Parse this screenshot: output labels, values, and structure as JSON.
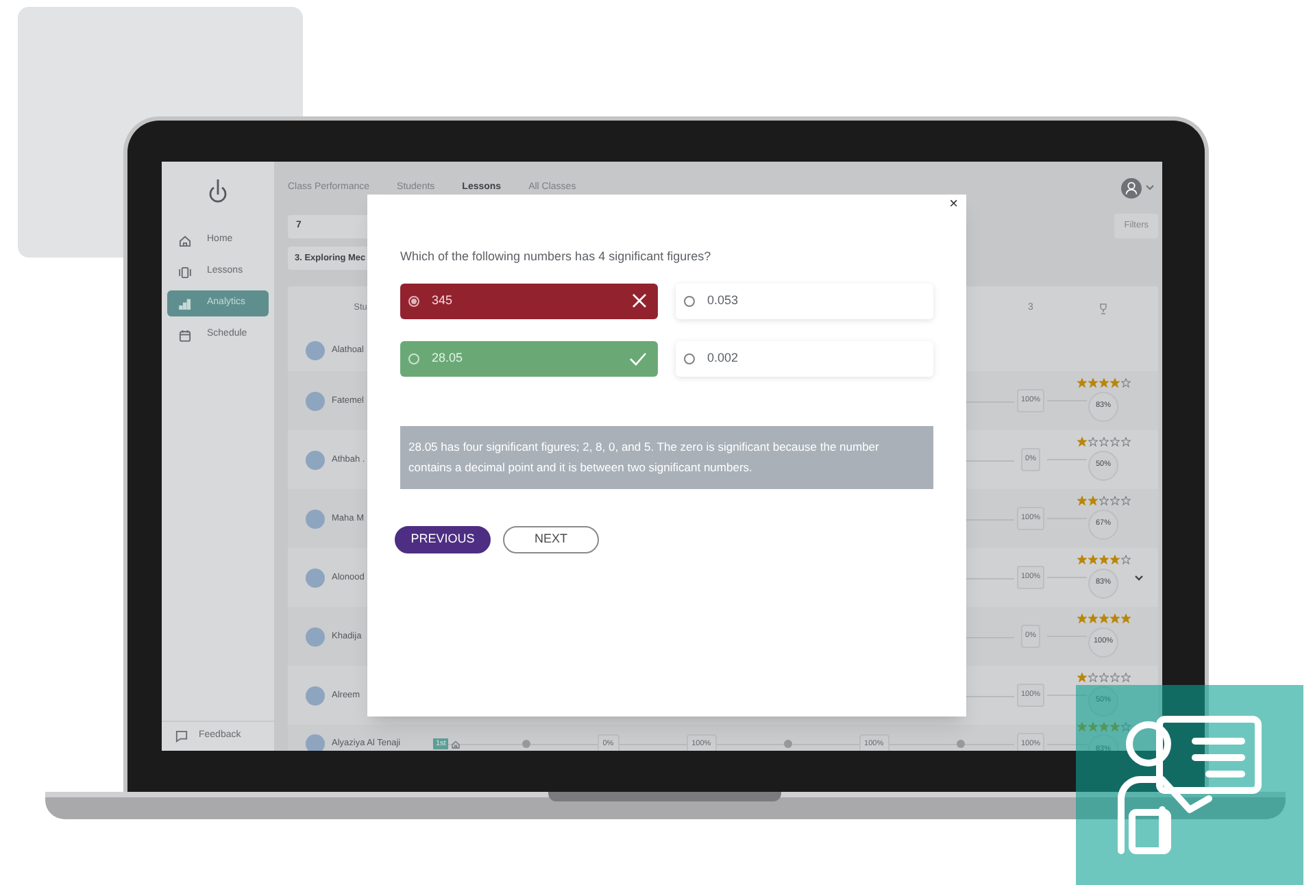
{
  "sidebar": {
    "items": [
      {
        "label": "Home",
        "selected": false
      },
      {
        "label": "Lessons",
        "selected": false
      },
      {
        "label": "Analytics",
        "selected": true
      },
      {
        "label": "Schedule",
        "selected": false
      }
    ],
    "footer": "Feedback"
  },
  "tabs": [
    {
      "label": "Class Performance",
      "selected": false
    },
    {
      "label": "Students",
      "selected": false
    },
    {
      "label": "Lessons",
      "selected": true
    },
    {
      "label": "All Classes",
      "selected": false
    }
  ],
  "filters": {
    "grade": "7",
    "lesson": "3. Exploring Mec",
    "button": "Filters"
  },
  "table": {
    "columns": [
      "Stu",
      "3"
    ],
    "rows": [
      {
        "name": "Alathoal",
        "expandable": false
      },
      {
        "name": "Fatemel",
        "score": "100%",
        "result": "83%",
        "stars": 4,
        "expandable": false
      },
      {
        "name": "Athbah .",
        "score": "0%",
        "result": "50%",
        "stars": 1,
        "expandable": false
      },
      {
        "name": "Maha M",
        "score": "100%",
        "result": "67%",
        "stars": 2,
        "expandable": false
      },
      {
        "name": "Alonood",
        "score": "100%",
        "result": "83%",
        "stars": 4,
        "expandable": true
      },
      {
        "name": "Khadija",
        "score": "0%",
        "result": "100%",
        "stars": 5,
        "expandable": false
      },
      {
        "name": "Alreem",
        "score": "100%",
        "result": "50%",
        "stars": 1,
        "expandable": false
      },
      {
        "name": "Alyaziya Al Tenaji",
        "badge": "1st",
        "progress": [
          "0%",
          "100%",
          "100%"
        ],
        "score": "100%",
        "result": "83%",
        "stars": 4,
        "expandable": false
      }
    ]
  },
  "modal": {
    "close": "×",
    "question": "Which of the following numbers has 4 significant figures?",
    "options": [
      {
        "text": "345",
        "kind": "wrong",
        "selected": true
      },
      {
        "text": "0.053",
        "kind": "plain",
        "selected": false
      },
      {
        "text": "28.05",
        "kind": "correct",
        "selected": false
      },
      {
        "text": "0.002",
        "kind": "plain",
        "selected": false
      }
    ],
    "explanation": "28.05 has four significant figures; 2, 8, 0, and 5. The zero is significant because the number contains a decimal point and it is between two significant numbers.",
    "buttons": [
      {
        "label": "PREVIOUS",
        "kind": "primary"
      },
      {
        "label": "NEXT",
        "kind": "outline"
      }
    ]
  }
}
